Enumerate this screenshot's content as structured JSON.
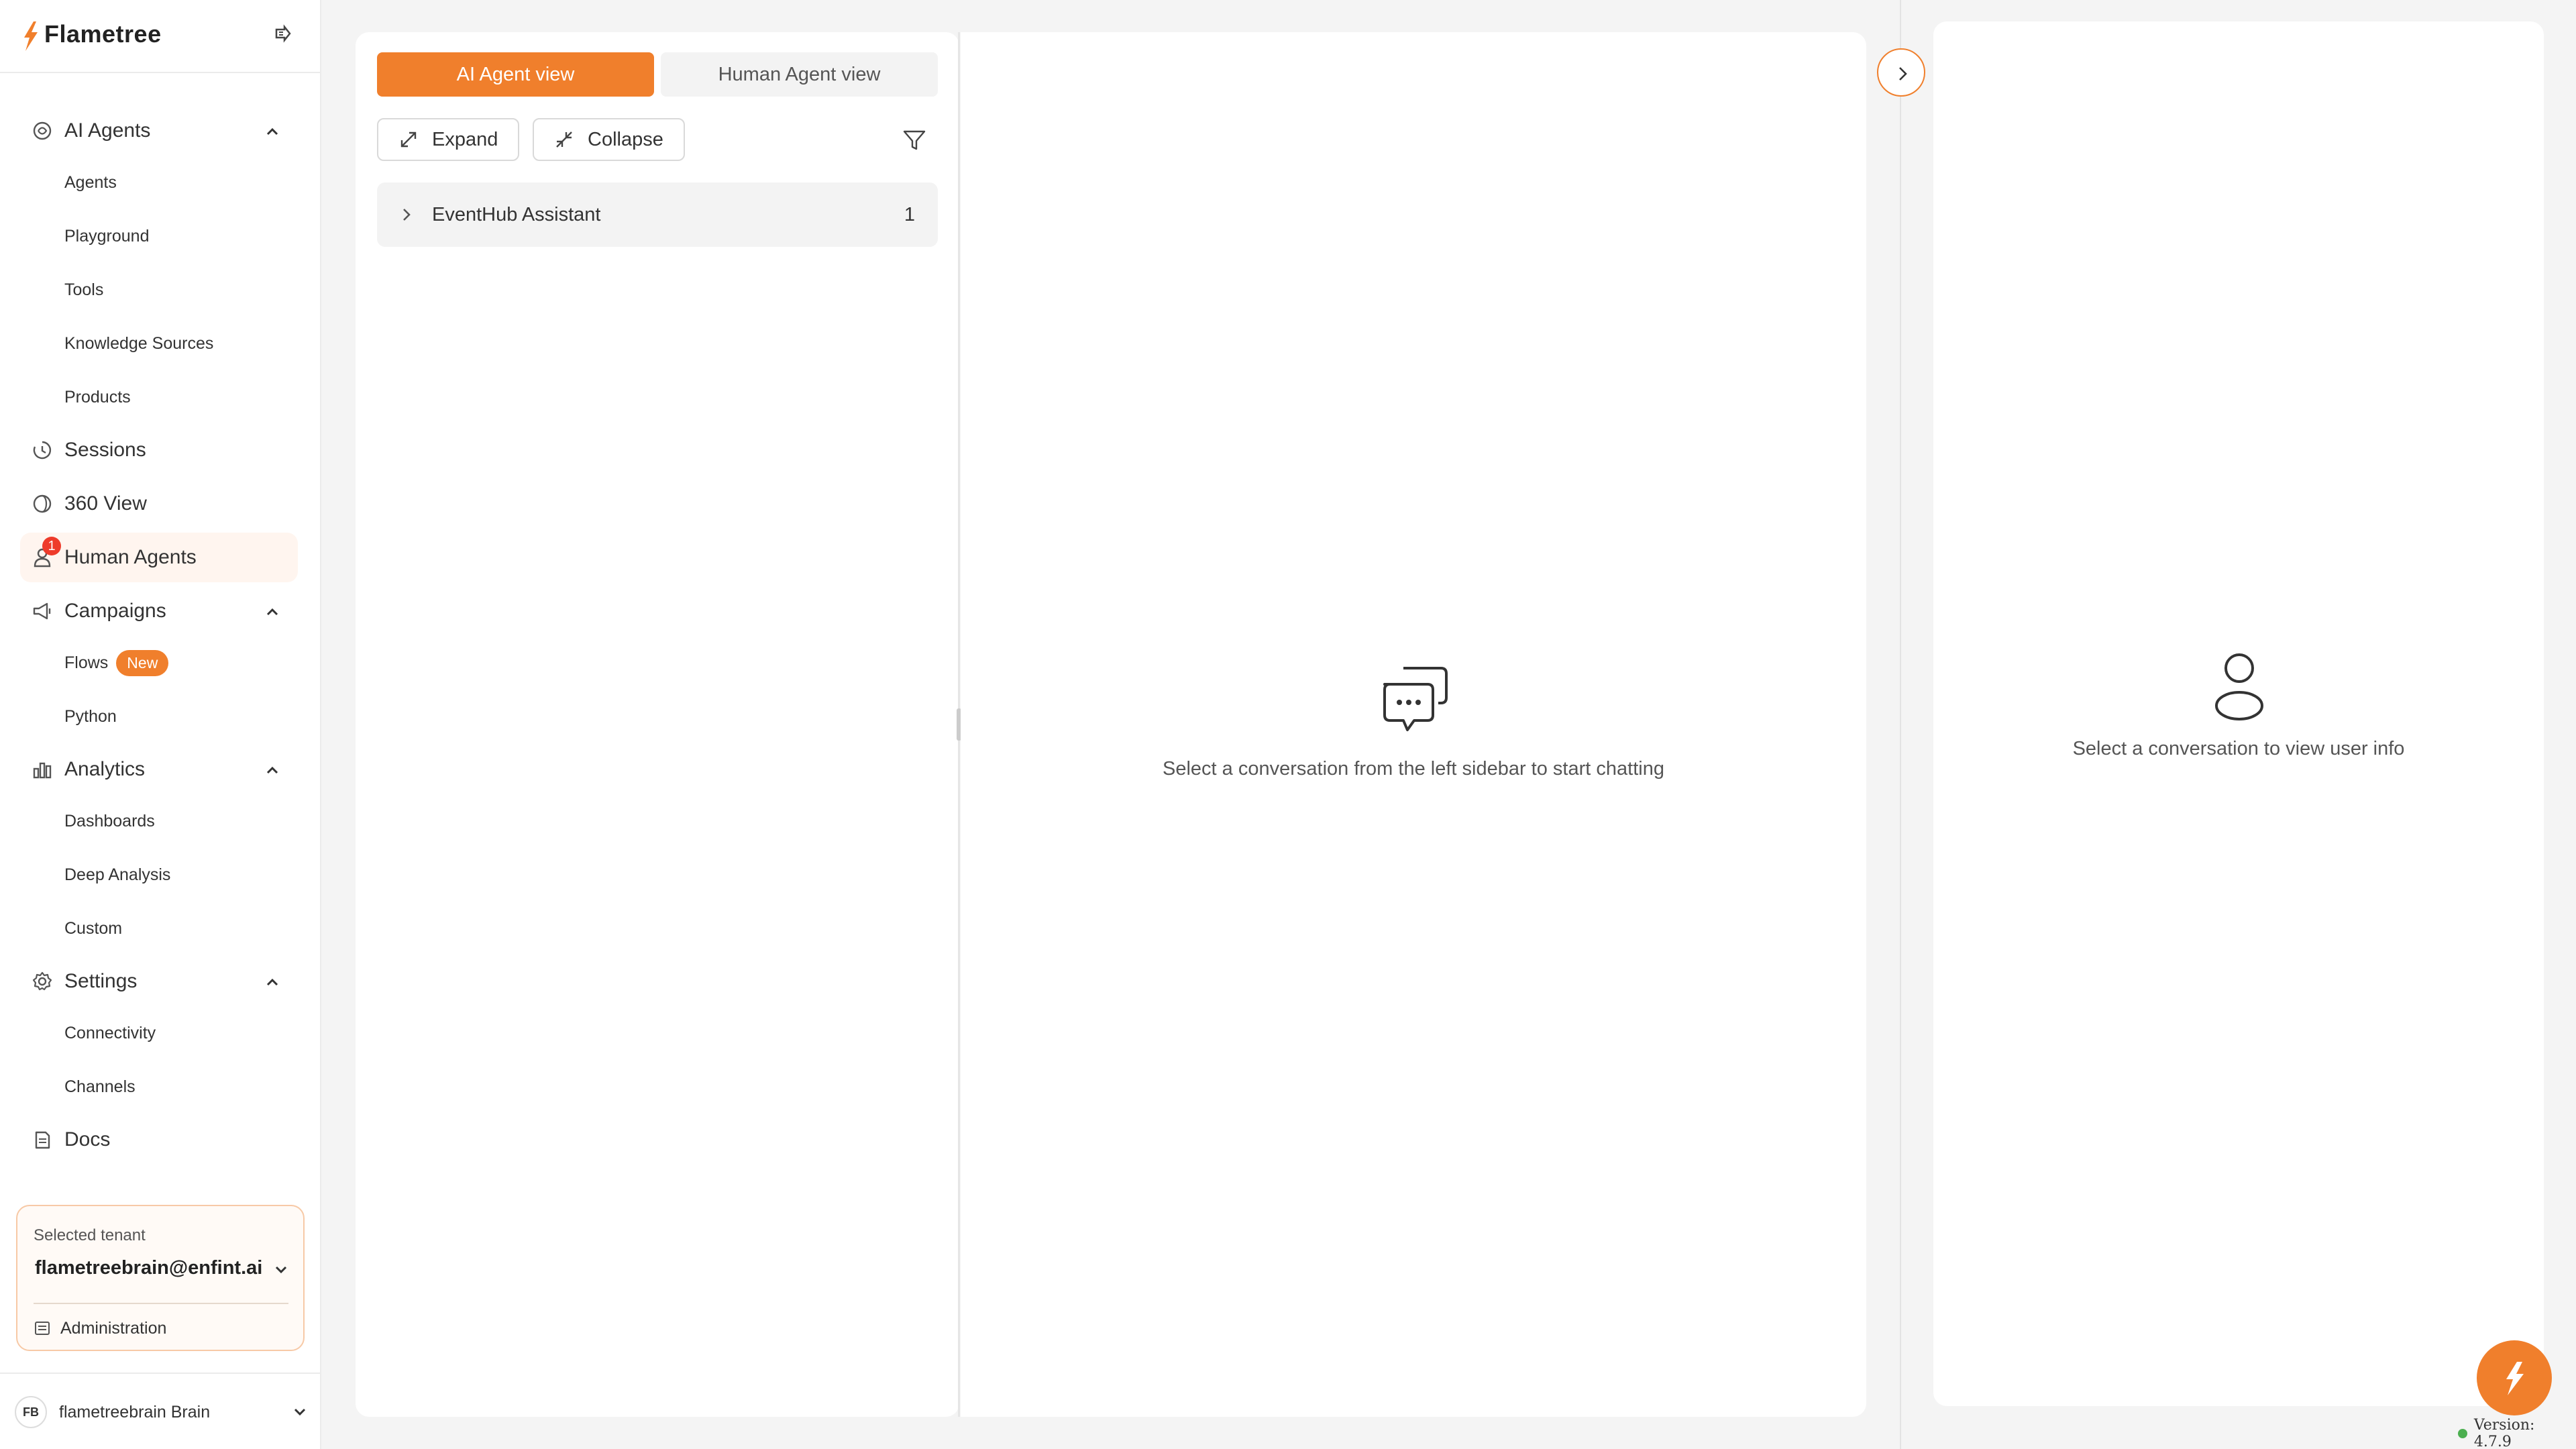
{
  "brand": {
    "name": "Flametree",
    "icon": "flametree-logo",
    "accent": "#f07f2c"
  },
  "sidebar": {
    "sections": [
      {
        "label": "AI Agents",
        "icon": "ai-agents-icon",
        "expanded": true,
        "items": [
          "Agents",
          "Playground",
          "Tools",
          "Knowledge Sources",
          "Products"
        ]
      },
      {
        "label": "Sessions",
        "icon": "sessions-icon"
      },
      {
        "label": "360 View",
        "icon": "360-view-icon"
      },
      {
        "label": "Human Agents",
        "icon": "human-agents-icon",
        "active": true,
        "badge": "1"
      },
      {
        "label": "Campaigns",
        "icon": "campaigns-icon",
        "expanded": true,
        "items": [
          "Flows",
          "Python"
        ],
        "flows_badge": "New"
      },
      {
        "label": "Analytics",
        "icon": "analytics-icon",
        "expanded": true,
        "items": [
          "Dashboards",
          "Deep Analysis",
          "Custom"
        ]
      },
      {
        "label": "Settings",
        "icon": "settings-icon",
        "expanded": true,
        "items": [
          "Connectivity",
          "Channels"
        ]
      },
      {
        "label": "Docs",
        "icon": "docs-icon"
      }
    ],
    "tenant": {
      "label": "Selected tenant",
      "value": "flametreebrain@enfint.ai",
      "admin_label": "Administration"
    },
    "user": {
      "initials": "FB",
      "name": "flametreebrain Brain"
    }
  },
  "list_panel": {
    "tabs": [
      "AI Agent view",
      "Human Agent view"
    ],
    "active_tab": "AI Agent view",
    "expand_label": "Expand",
    "collapse_label": "Collapse",
    "groups": [
      {
        "name": "EventHub Assistant",
        "count": "1"
      }
    ]
  },
  "chat_panel": {
    "empty_text": "Select a conversation from the left sidebar to start chatting"
  },
  "info_panel": {
    "empty_text": "Select a conversation to view user info"
  },
  "version": "Version: 4.7.9"
}
